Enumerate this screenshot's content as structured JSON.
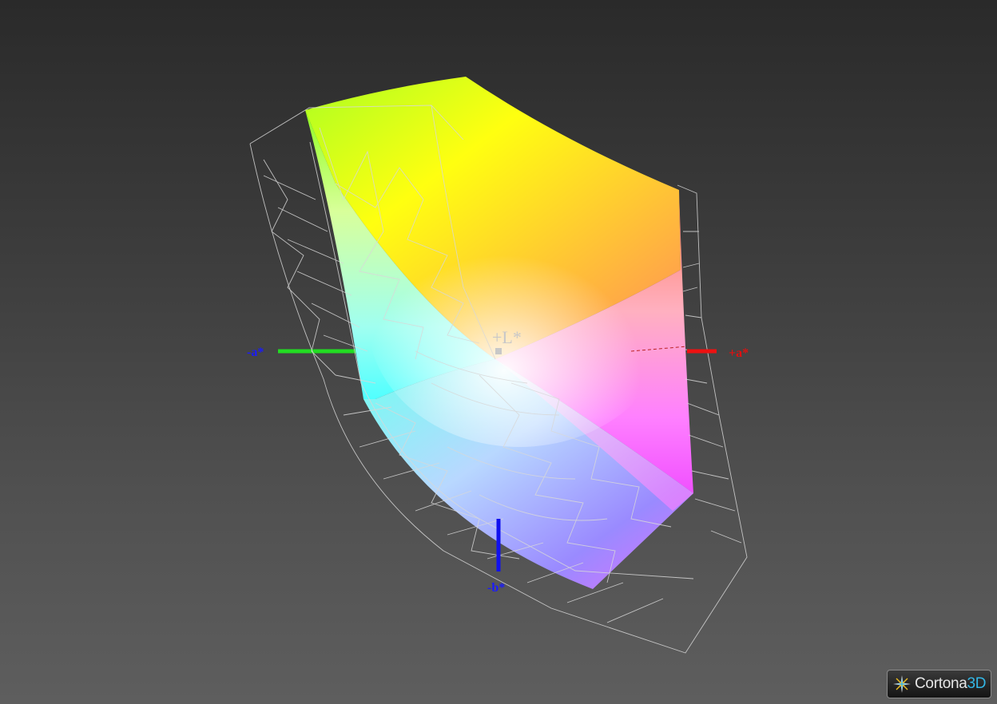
{
  "axes": {
    "neg_a": "-a*",
    "pos_a": "+a*",
    "neg_b": "-b*",
    "pos_l": "+L*"
  },
  "colors": {
    "neg_a_axis": "#22dd22",
    "pos_a_axis": "#ee1111",
    "neg_b_axis": "#1111ee",
    "wireframe": "#d8d8d8"
  },
  "logo": {
    "brand": "Cortona",
    "accent": "3D",
    "icon": "cortona-star-icon"
  }
}
